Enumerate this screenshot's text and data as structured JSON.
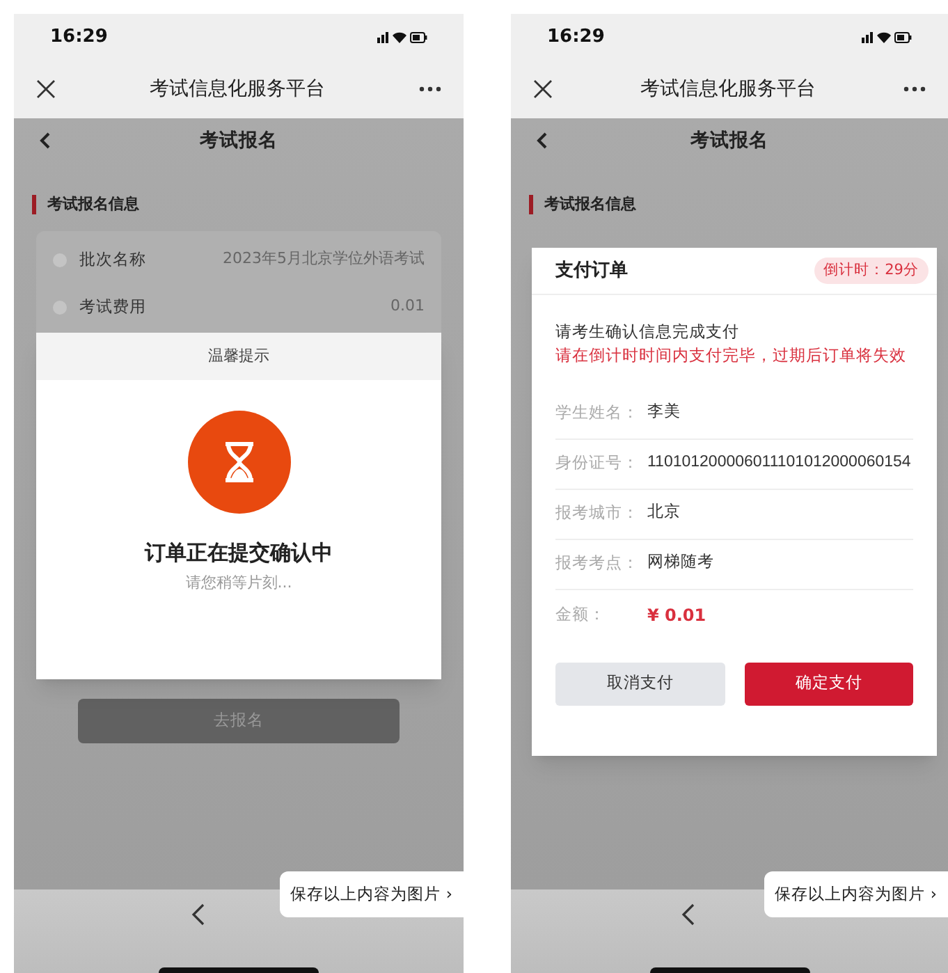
{
  "phones": [
    {
      "status_bar": {
        "time": "16:29"
      },
      "nav_bar": {
        "title": "考试信息化服务平台"
      },
      "page": {
        "title": "考试报名",
        "section_title": "考试报名信息",
        "rows": [
          {
            "label": "批次名称",
            "value": "2023年5月北京学位外语考试"
          },
          {
            "label": "考试费用",
            "value": "0.01"
          }
        ],
        "button": "去报名"
      },
      "dialog": {
        "kind": "loading",
        "header": "温馨提示",
        "message": "订单正在提交确认中",
        "hint": "请您稍等片刻..."
      },
      "save_prompt": "保存以上内容为图片 ›"
    },
    {
      "status_bar": {
        "time": "16:29"
      },
      "nav_bar": {
        "title": "考试信息化服务平台"
      },
      "page": {
        "title": "考试报名",
        "section_title": "考试报名信息"
      },
      "dialog": {
        "kind": "payment",
        "title": "支付订单",
        "countdown": "倒计时：29分",
        "notice": "请考生确认信息完成支付",
        "warning": "请在倒计时时间内支付完毕，过期后订单将失效",
        "fields": [
          {
            "label": "学生姓名：",
            "value": "李美",
            "kind": "text"
          },
          {
            "label": "身份证号：",
            "value": "110101200006011101012000060154",
            "kind": "text"
          },
          {
            "label": "报考城市：",
            "value": "北京",
            "kind": "text"
          },
          {
            "label": "报考考点：",
            "value": "网梯随考",
            "kind": "text"
          },
          {
            "label": "金额：",
            "value": "¥ 0.01",
            "kind": "amount"
          }
        ],
        "buttons": [
          {
            "label": "取消支付",
            "kind": "secondary"
          },
          {
            "label": "确定支付",
            "kind": "primary"
          }
        ]
      },
      "save_prompt": "保存以上内容为图片 ›"
    }
  ]
}
